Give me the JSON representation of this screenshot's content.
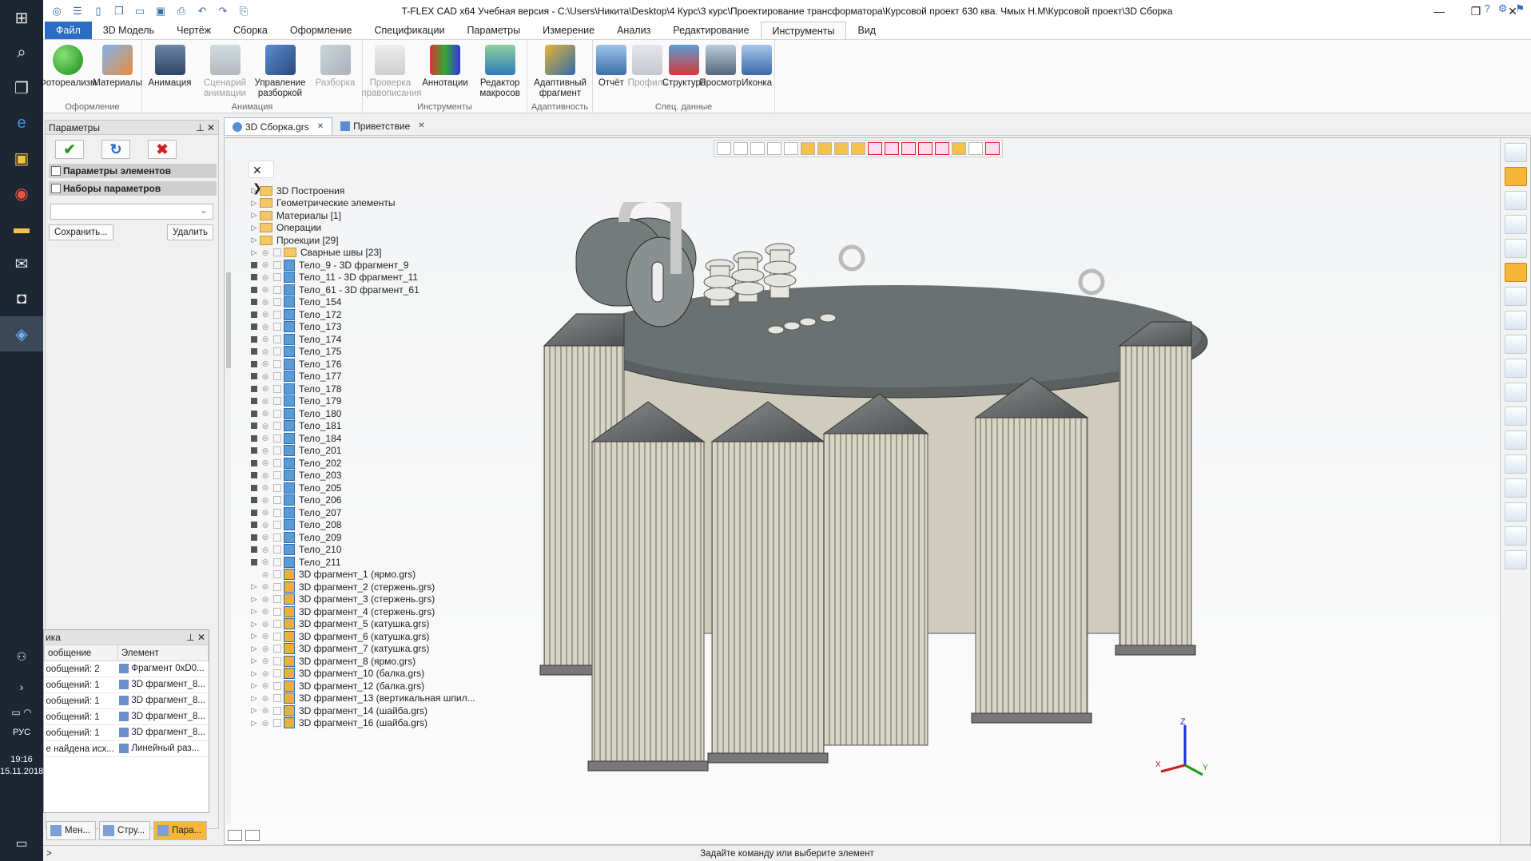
{
  "window": {
    "title": "T-FLEX CAD x64 Учебная версия - C:\\Users\\Никита\\Desktop\\4 Курс\\3 курс\\Проектирование трансформатора\\Курсовой проект 630 ква. Чмых Н.М\\Курсовой проект\\3D Сборка"
  },
  "menu": {
    "tabs": [
      "Файл",
      "3D Модель",
      "Чертёж",
      "Сборка",
      "Оформление",
      "Спецификации",
      "Параметры",
      "Измерение",
      "Анализ",
      "Редактирование",
      "Инструменты",
      "Вид"
    ],
    "selected": "Инструменты"
  },
  "ribbon": {
    "groups": [
      {
        "label": "Оформление",
        "buttons": [
          {
            "label": "Фотореализм",
            "icon": "green-sphere-icon",
            "enabled": true
          },
          {
            "label": "Материалы",
            "icon": "materials-icon",
            "enabled": true
          }
        ]
      },
      {
        "label": "Анимация",
        "buttons": [
          {
            "label": "Анимация",
            "icon": "film-icon",
            "enabled": true
          },
          {
            "label": "Сценарий анимации",
            "icon": "script-icon",
            "enabled": false
          },
          {
            "label": "Управление разборкой",
            "icon": "explode-control-icon",
            "enabled": true
          },
          {
            "label": "Разборка",
            "icon": "explode-icon",
            "enabled": false
          }
        ]
      },
      {
        "label": "Инструменты",
        "buttons": [
          {
            "label": "Проверка правописания",
            "icon": "spellcheck-icon",
            "enabled": false
          },
          {
            "label": "Аннотации",
            "icon": "annotations-icon",
            "enabled": true
          },
          {
            "label": "Редактор макросов",
            "icon": "macro-editor-icon",
            "enabled": true
          }
        ]
      },
      {
        "label": "Адаптивность",
        "buttons": [
          {
            "label": "Адаптивный фрагмент",
            "icon": "adaptive-fragment-icon",
            "enabled": true
          }
        ]
      },
      {
        "label": "Спец. данные",
        "buttons": [
          {
            "label": "Отчёт",
            "icon": "report-icon",
            "enabled": true
          },
          {
            "label": "Профиль",
            "icon": "profile-icon",
            "enabled": false
          },
          {
            "label": "Структура",
            "icon": "structure-icon",
            "enabled": true
          },
          {
            "label": "Просмотр",
            "icon": "camera-icon",
            "enabled": true
          },
          {
            "label": "Иконка",
            "icon": "icon-editor-icon",
            "enabled": true
          }
        ]
      }
    ]
  },
  "params_panel": {
    "title": "Параметры",
    "section1": "Параметры элементов",
    "section2": "Наборы параметров",
    "save_label": "Сохранить...",
    "delete_label": "Удалить"
  },
  "diag_panel": {
    "title": "ика",
    "columns": [
      "ообщение",
      "Элемент"
    ],
    "rows": [
      {
        "msg": "ообщений: 2",
        "elem": "Фрагмент 0xD0..."
      },
      {
        "msg": "ообщений: 1",
        "elem": "3D фрагмент_8..."
      },
      {
        "msg": "ообщений: 1",
        "elem": "3D фрагмент_8..."
      },
      {
        "msg": "ообщений: 1",
        "elem": "3D фрагмент_8..."
      },
      {
        "msg": "ообщений: 1",
        "elem": "3D фрагмент_8..."
      },
      {
        "msg": "е найдена исх...",
        "elem": "Линейный раз..."
      }
    ]
  },
  "bottom_tabs": [
    "Мен...",
    "Стру...",
    "Пара..."
  ],
  "doc_tabs": [
    {
      "label": "3D Сборка.grs",
      "selected": true
    },
    {
      "label": "Приветствие",
      "selected": false
    }
  ],
  "tree": {
    "folders": [
      "3D Построения",
      "Геометрические элементы",
      "Материалы [1]",
      "Операции",
      "Проекции [29]",
      "Сварные швы [23]"
    ],
    "bodies": [
      "Тело_9 - 3D фрагмент_9",
      "Тело_11 - 3D фрагмент_11",
      "Тело_61 - 3D фрагмент_61",
      "Тело_154",
      "Тело_172",
      "Тело_173",
      "Тело_174",
      "Тело_175",
      "Тело_176",
      "Тело_177",
      "Тело_178",
      "Тело_179",
      "Тело_180",
      "Тело_181",
      "Тело_184",
      "Тело_201",
      "Тело_202",
      "Тело_203",
      "Тело_205",
      "Тело_206",
      "Тело_207",
      "Тело_208",
      "Тело_209",
      "Тело_210",
      "Тело_211"
    ],
    "fragments": [
      "3D фрагмент_1 (ярмо.grs)",
      "3D фрагмент_2 (стержень.grs)",
      "3D фрагмент_3 (стержень.grs)",
      "3D фрагмент_4 (стержень.grs)",
      "3D фрагмент_5 (катушка.grs)",
      "3D фрагмент_6 (катушка.grs)",
      "3D фрагмент_7 (катушка.grs)",
      "3D фрагмент_8 (ярмо.grs)",
      "3D фрагмент_10 (балка.grs)",
      "3D фрагмент_12 (балка.grs)",
      "3D фрагмент_13 (вертикальная шпил...",
      "3D фрагмент_14 (шайба.grs)",
      "3D фрагмент_16 (шайба.grs)"
    ]
  },
  "axes": {
    "x": "X",
    "y": "Y",
    "z": "Z"
  },
  "status": {
    "prompt": ">",
    "message": "Задайте команду или выберите элемент"
  },
  "taskbar": {
    "lang": "РУС",
    "time": "19:16",
    "date": "15.11.2018"
  },
  "colors": {
    "accent": "#2b6cc4",
    "highlight": "#f5b63a",
    "model_body": "#d8d4c6",
    "model_dark": "#5a5f5f"
  }
}
